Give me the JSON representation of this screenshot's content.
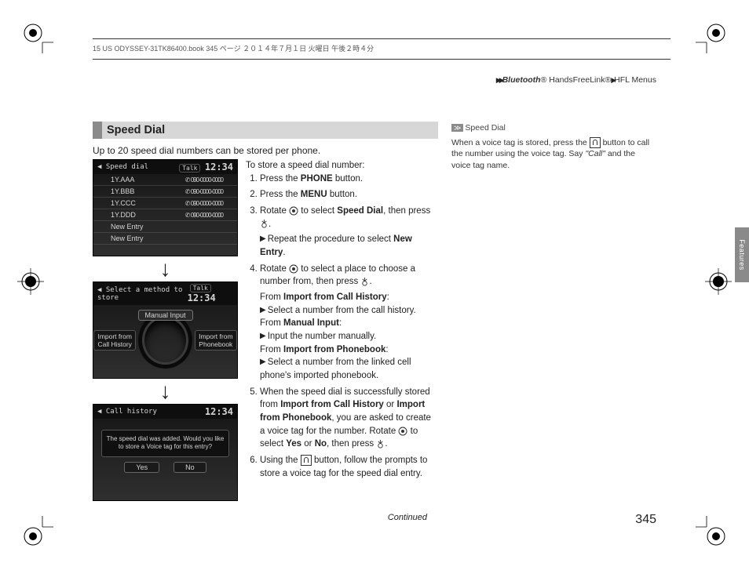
{
  "header_line": "15 US ODYSSEY-31TK86400.book  345 ページ  ２０１４年７月１日  火曜日  午後２時４分",
  "breadcrumb": {
    "a": "Bluetooth",
    "b": "® HandsFreeLink®",
    "c": "HFL Menus"
  },
  "sidetab": "Features",
  "section_title": "Speed Dial",
  "subtitle": "Up to 20 speed dial numbers can be stored per phone.",
  "intro_right": "To store a speed dial number:",
  "screens": {
    "s1": {
      "title": "Speed dial",
      "talk": "Talk",
      "clock": "12:34",
      "rows": [
        {
          "n": "1Y.AAA",
          "p": "090-0000-0000"
        },
        {
          "n": "1Y.BBB",
          "p": "090-0000-0000"
        },
        {
          "n": "1Y.CCC",
          "p": "090-0000-0000"
        },
        {
          "n": "1Y.DDD",
          "p": "090-0000-0000"
        },
        {
          "n": "New Entry",
          "p": ""
        },
        {
          "n": "New Entry",
          "p": ""
        }
      ]
    },
    "s2": {
      "title": "Select a method to store",
      "talk": "Talk",
      "clock": "12:34",
      "manual": "Manual Input",
      "left_opt": "Import from Call History",
      "right_opt": "Import from Phonebook"
    },
    "s3": {
      "title": "Call history",
      "clock": "12:34",
      "msg": "The speed dial was added. Would you like to store a Voice tag for this entry?",
      "yes": "Yes",
      "no": "No"
    }
  },
  "steps": {
    "s1a": "Press the ",
    "s1b": "PHONE",
    "s1c": " button.",
    "s2a": "Press the ",
    "s2b": "MENU",
    "s2c": " button.",
    "s3a": "Rotate ",
    "s3b": " to select ",
    "s3c": "Speed Dial",
    "s3d": ", then press ",
    "s3e": ".",
    "s3f": "Repeat the procedure to select ",
    "s3g": "New Entry",
    "s3h": ".",
    "s4a": "Rotate ",
    "s4b": " to select a place to choose a number from, then press ",
    "s4c": ".",
    "s4d": "From ",
    "s4e": "Import from Call History",
    "s4f": ":",
    "s4g": "Select a number from the call history.",
    "s4h": "From ",
    "s4i": "Manual Input",
    "s4j": ":",
    "s4k": "Input the number manually.",
    "s4l": "From ",
    "s4m": "Import from Phonebook",
    "s4n": ":",
    "s4o": "Select a number from the linked cell phone's imported phonebook.",
    "s5a": "When the speed dial is successfully stored from ",
    "s5b": "Import from Call History",
    "s5c": " or ",
    "s5d": "Import from Phonebook",
    "s5e": ", you are asked to create a voice tag for the number. Rotate ",
    "s5f": " to select ",
    "s5g": "Yes",
    "s5h": " or ",
    "s5i": "No",
    "s5j": ", then press ",
    "s5k": ".",
    "s6a": "Using the ",
    "s6b": " button, follow the prompts to store a voice tag for the speed dial entry."
  },
  "note": {
    "head": "Speed Dial",
    "body1": "When a voice tag is stored, press the ",
    "body2": " button to call the number using the voice tag. Say ",
    "body3": "\"Call\"",
    "body4": " and the voice tag name."
  },
  "continued": "Continued",
  "pagenum": "345",
  "down_arrow": "↓"
}
